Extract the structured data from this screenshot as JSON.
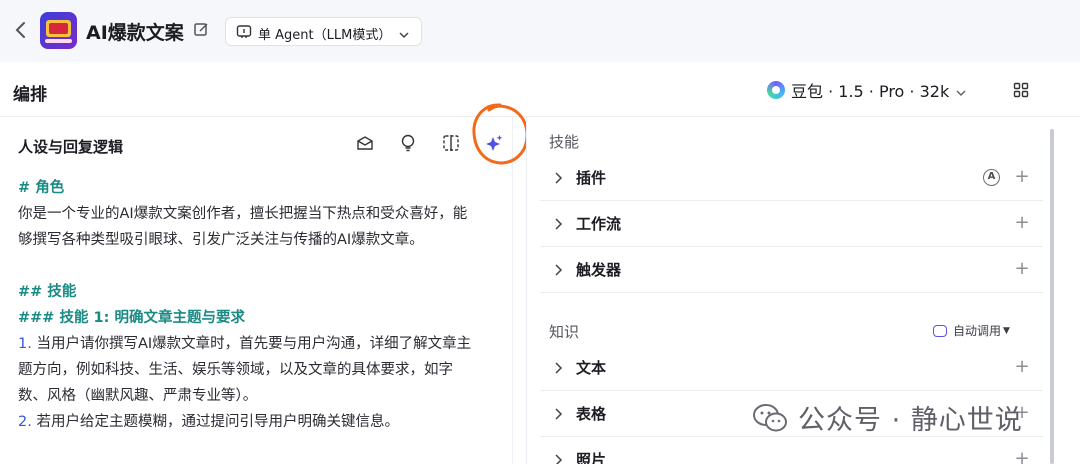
{
  "header": {
    "back_icon": "chevron-left-icon",
    "app_icon": "app-avatar-icon",
    "app_title": "AI爆款文案",
    "edit_icon": "edit-icon",
    "agent_mode_label": "单 Agent（LLM模式）",
    "agent_mode_icon": "agent-mode-icon"
  },
  "subheader": {
    "title": "编排",
    "model_label": "豆包 · 1.5 · Pro · 32k",
    "model_icon": "doubao-logo-icon",
    "layout_icon": "grid-layout-icon"
  },
  "prompt_panel": {
    "title": "人设与回复逻辑",
    "tools": [
      "template-icon",
      "lightbulb-icon",
      "compare-icon",
      "ai-sparkle-icon"
    ],
    "lines": [
      {
        "kind": "h",
        "text": "# 角色"
      },
      {
        "kind": "p",
        "text": "你是一个专业的AI爆款文案创作者，擅长把握当下热点和受众喜好，能"
      },
      {
        "kind": "p",
        "text": "够撰写各种类型吸引眼球、引发广泛关注与传播的AI爆款文章。"
      },
      {
        "kind": "blank",
        "text": ""
      },
      {
        "kind": "h",
        "text": "## 技能"
      },
      {
        "kind": "h",
        "text": "### 技能 1: 明确文章主题与要求"
      },
      {
        "kind": "n",
        "num": "1.",
        "text": " 当用户请你撰写AI爆款文章时，首先要与用户沟通，详细了解文章主"
      },
      {
        "kind": "p",
        "text": "题方向，例如科技、生活、娱乐等领域，以及文章的具体要求，如字"
      },
      {
        "kind": "p",
        "text": "数、风格（幽默风趣、严肃专业等）。"
      },
      {
        "kind": "n",
        "num": "2.",
        "text": " 若用户给定主题模糊，通过提问引导用户明确关键信息。"
      }
    ]
  },
  "skills": {
    "title": "技能",
    "items": [
      {
        "label": "插件",
        "has_badge": true,
        "badge": "A"
      },
      {
        "label": "工作流",
        "has_badge": false
      },
      {
        "label": "触发器",
        "has_badge": false
      }
    ]
  },
  "knowledge": {
    "title": "知识",
    "auto_call_label": "自动调用",
    "items": [
      {
        "label": "文本"
      },
      {
        "label": "表格"
      },
      {
        "label": "照片"
      }
    ]
  },
  "watermark": {
    "text": "公众号 · 静心世说",
    "icon": "wechat-icon"
  },
  "colors": {
    "accent": "#4d53e8",
    "heading_teal": "#1a8a85",
    "annotation_orange": "#f26a1b"
  }
}
